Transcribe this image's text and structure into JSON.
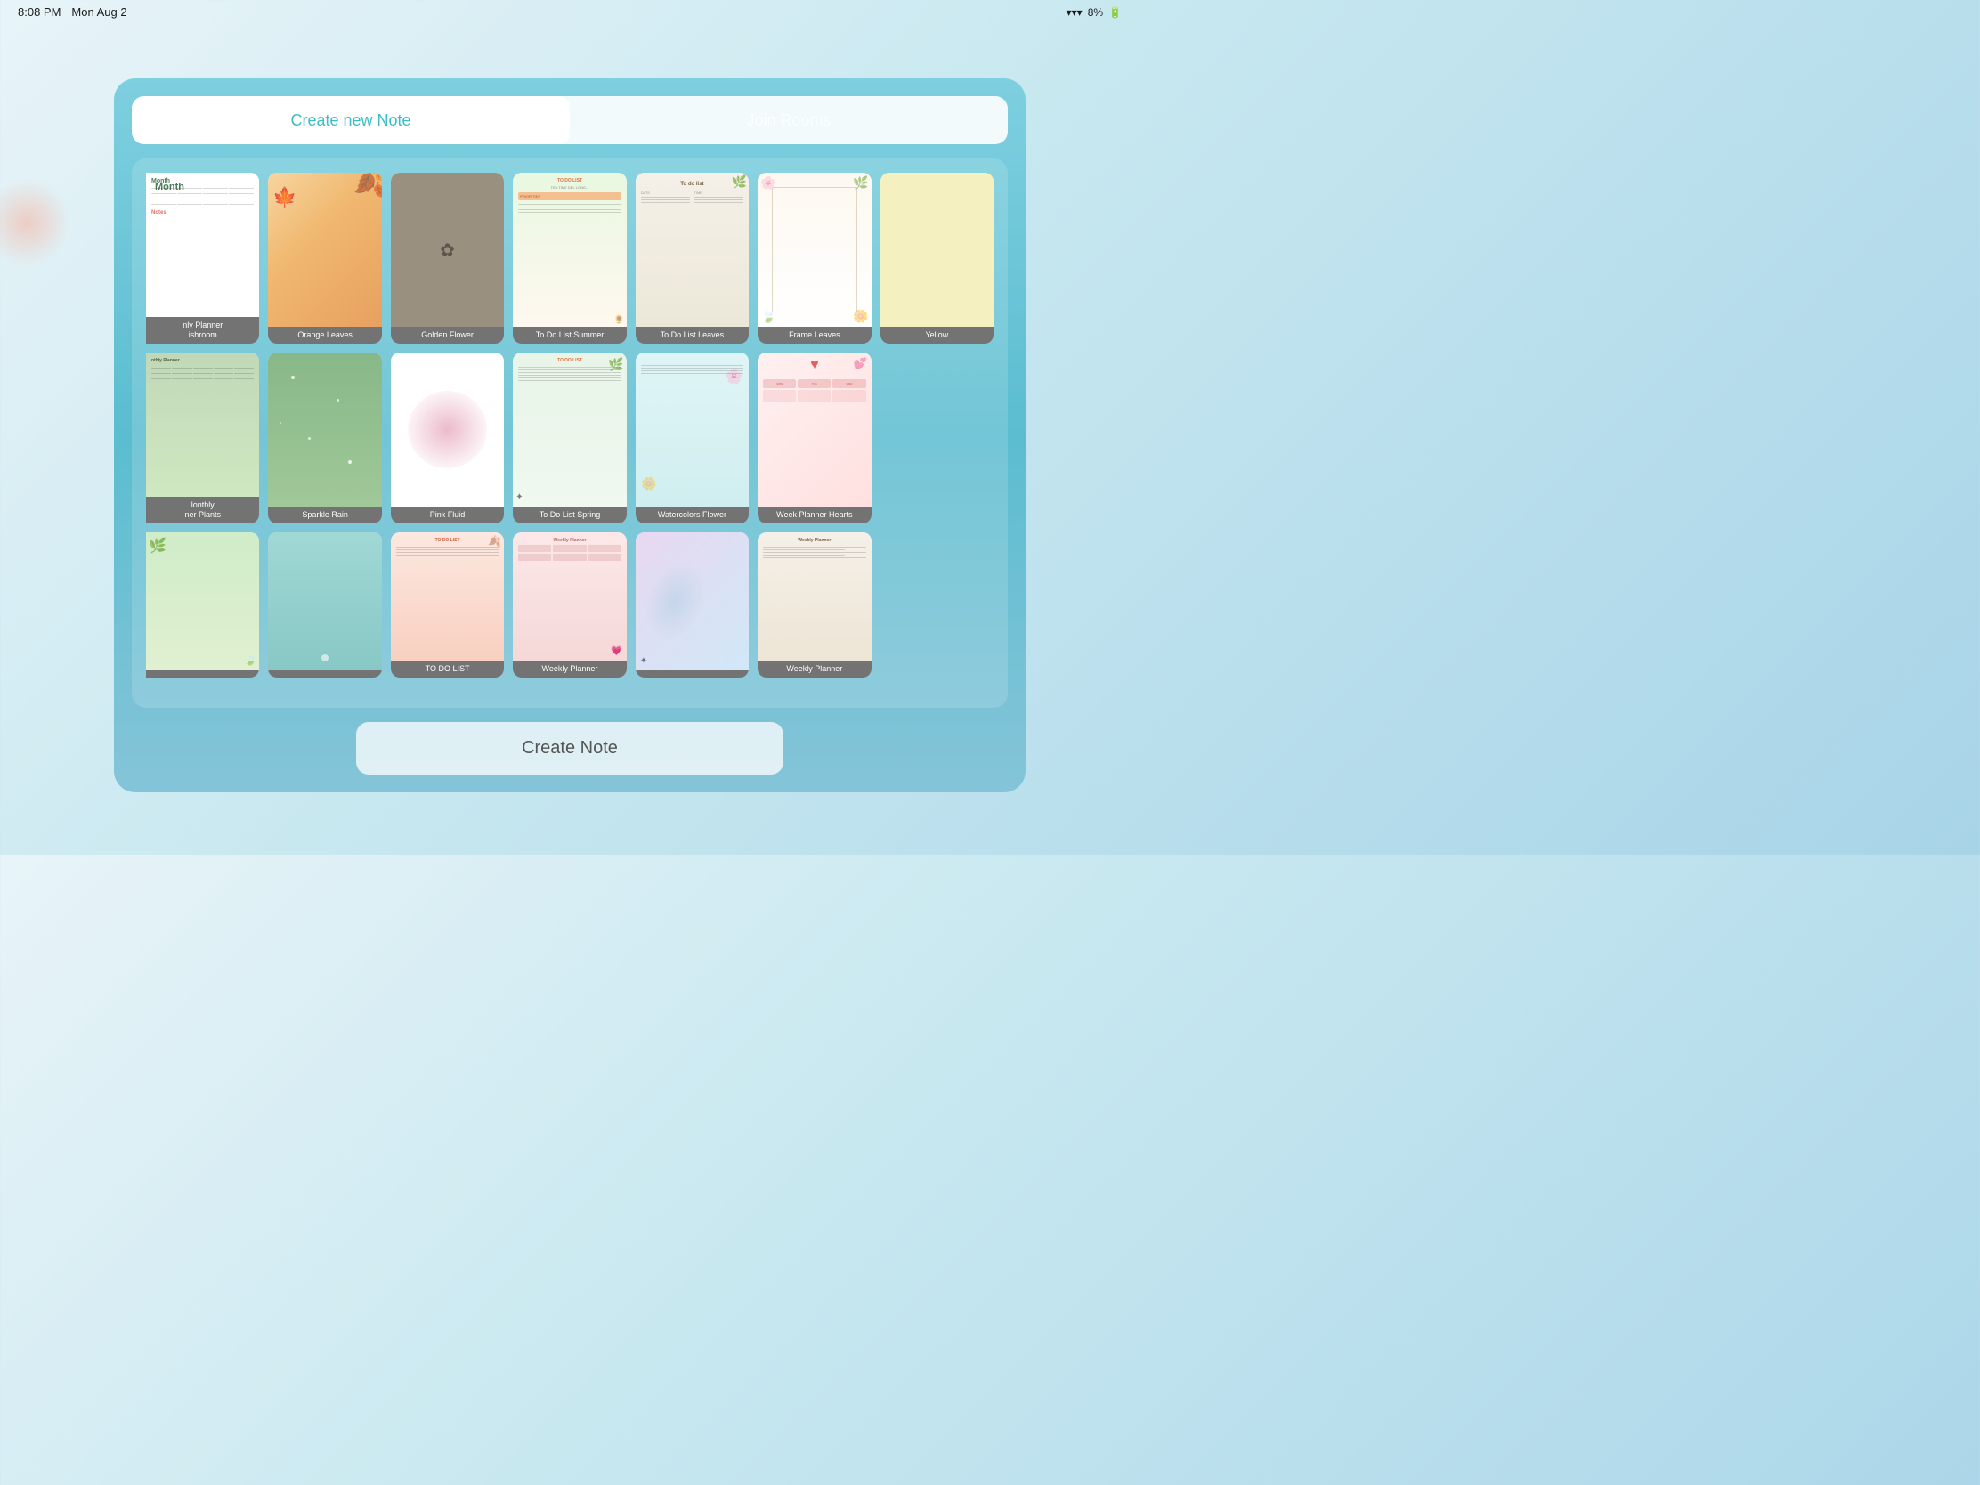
{
  "statusBar": {
    "time": "8:08 PM",
    "date": "Mon Aug 2",
    "wifi": "WiFi",
    "battery": "8%"
  },
  "tabs": {
    "createNote": "Create new Note",
    "joinRooms": "Join Rooms"
  },
  "createNoteButton": "Create Note",
  "templates": [
    {
      "id": "monthly-planner-mushroom",
      "label": "nly Planner\nishroom",
      "preview": "monthly-planner",
      "partial": true
    },
    {
      "id": "orange-leaves",
      "label": "Orange Leaves",
      "preview": "orange-leaves"
    },
    {
      "id": "golden-flower",
      "label": "Golden Flower",
      "preview": "golden-flower"
    },
    {
      "id": "todo-list-summer",
      "label": "To Do List Summer",
      "preview": "todo-summer"
    },
    {
      "id": "todo-list-leaves",
      "label": "To Do List Leaves",
      "preview": "todo-leaves"
    },
    {
      "id": "frame-leaves",
      "label": "Frame Leaves",
      "preview": "frame-leaves"
    },
    {
      "id": "yellow",
      "label": "Yellow",
      "preview": "yellow"
    },
    {
      "id": "monthly-inner-plants",
      "label": "lonthly\nner Plants",
      "preview": "monthly-plants",
      "partial": true
    },
    {
      "id": "sparkle-rain",
      "label": "Sparkle Rain",
      "preview": "sparkle-rain"
    },
    {
      "id": "pink-fluid",
      "label": "Pink Fluid",
      "preview": "pink-fluid"
    },
    {
      "id": "todo-list-spring",
      "label": "To Do List Spring",
      "preview": "todo-spring"
    },
    {
      "id": "watercolors-flower",
      "label": "Watercolors Flower",
      "preview": "watercolors-flower"
    },
    {
      "id": "week-planner-hearts",
      "label": "Week Planner Hearts",
      "preview": "week-planner-hearts"
    },
    {
      "id": "empty-r2c7",
      "label": "",
      "preview": "empty"
    },
    {
      "id": "green-plant",
      "label": "",
      "preview": "green-plant",
      "partial": true
    },
    {
      "id": "teal-gradient",
      "label": "",
      "preview": "teal-gradient"
    },
    {
      "id": "todo-pink",
      "label": "TO DO LIST",
      "preview": "todo-pink"
    },
    {
      "id": "weekly-planner-pink",
      "label": "Weekly Planner",
      "preview": "weekly-planner-pink"
    },
    {
      "id": "watercolor-abstract",
      "label": "",
      "preview": "watercolor-abstract"
    },
    {
      "id": "weekly-planner-beige",
      "label": "Weekly Planner",
      "preview": "weekly-planner-beige"
    },
    {
      "id": "empty-r3c7",
      "label": "",
      "preview": "empty"
    }
  ]
}
